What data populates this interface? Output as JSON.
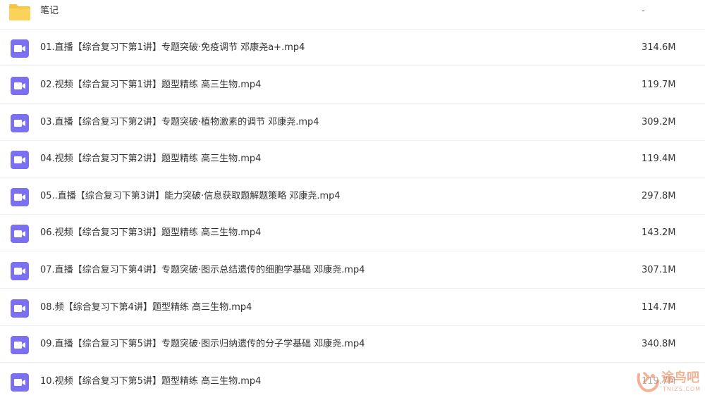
{
  "colors": {
    "folder_icon": "#f9c43d",
    "video_icon": "#7b6ff2",
    "watermark": "#e8743b"
  },
  "folder": {
    "name": "笔记",
    "size": "-",
    "icon": "folder-icon"
  },
  "files": [
    {
      "name": "01.直播【综合复习下第1讲】专题突破·免疫调节 邓康尧a+.mp4",
      "size": "314.6M",
      "icon": "video-file-icon"
    },
    {
      "name": "02.视频【综合复习下第1讲】题型精练 高三生物.mp4",
      "size": "119.7M",
      "icon": "video-file-icon"
    },
    {
      "name": "03.直播【综合复习下第2讲】专题突破·植物激素的调节 邓康尧.mp4",
      "size": "309.2M",
      "icon": "video-file-icon"
    },
    {
      "name": "04.视频【综合复习下第2讲】题型精练 高三生物.mp4",
      "size": "119.4M",
      "icon": "video-file-icon"
    },
    {
      "name": "05..直播【综合复习下第3讲】能力突破·信息获取题解题策略 邓康尧.mp4",
      "size": "297.8M",
      "icon": "video-file-icon"
    },
    {
      "name": "06.视频【综合复习下第3讲】题型精练 高三生物.mp4",
      "size": "143.2M",
      "icon": "video-file-icon"
    },
    {
      "name": "07.直播【综合复习下第4讲】专题突破·图示总结遗传的细胞学基础 邓康尧.mp4",
      "size": "307.1M",
      "icon": "video-file-icon"
    },
    {
      "name": "08.频【综合复习下第4讲】题型精练 高三生物.mp4",
      "size": "114.7M",
      "icon": "video-file-icon"
    },
    {
      "name": "09.直播【综合复习下第5讲】专题突破·图示归纳遗传的分子学基础 邓康尧.mp4",
      "size": "340.8M",
      "icon": "video-file-icon"
    },
    {
      "name": "10.视频【综合复习下第5讲】题型精练 高三生物.mp4",
      "size": "119.7M",
      "icon": "video-file-icon"
    }
  ],
  "watermark": {
    "text": "途鸟吧",
    "subtext": "TNIZS.COM"
  }
}
